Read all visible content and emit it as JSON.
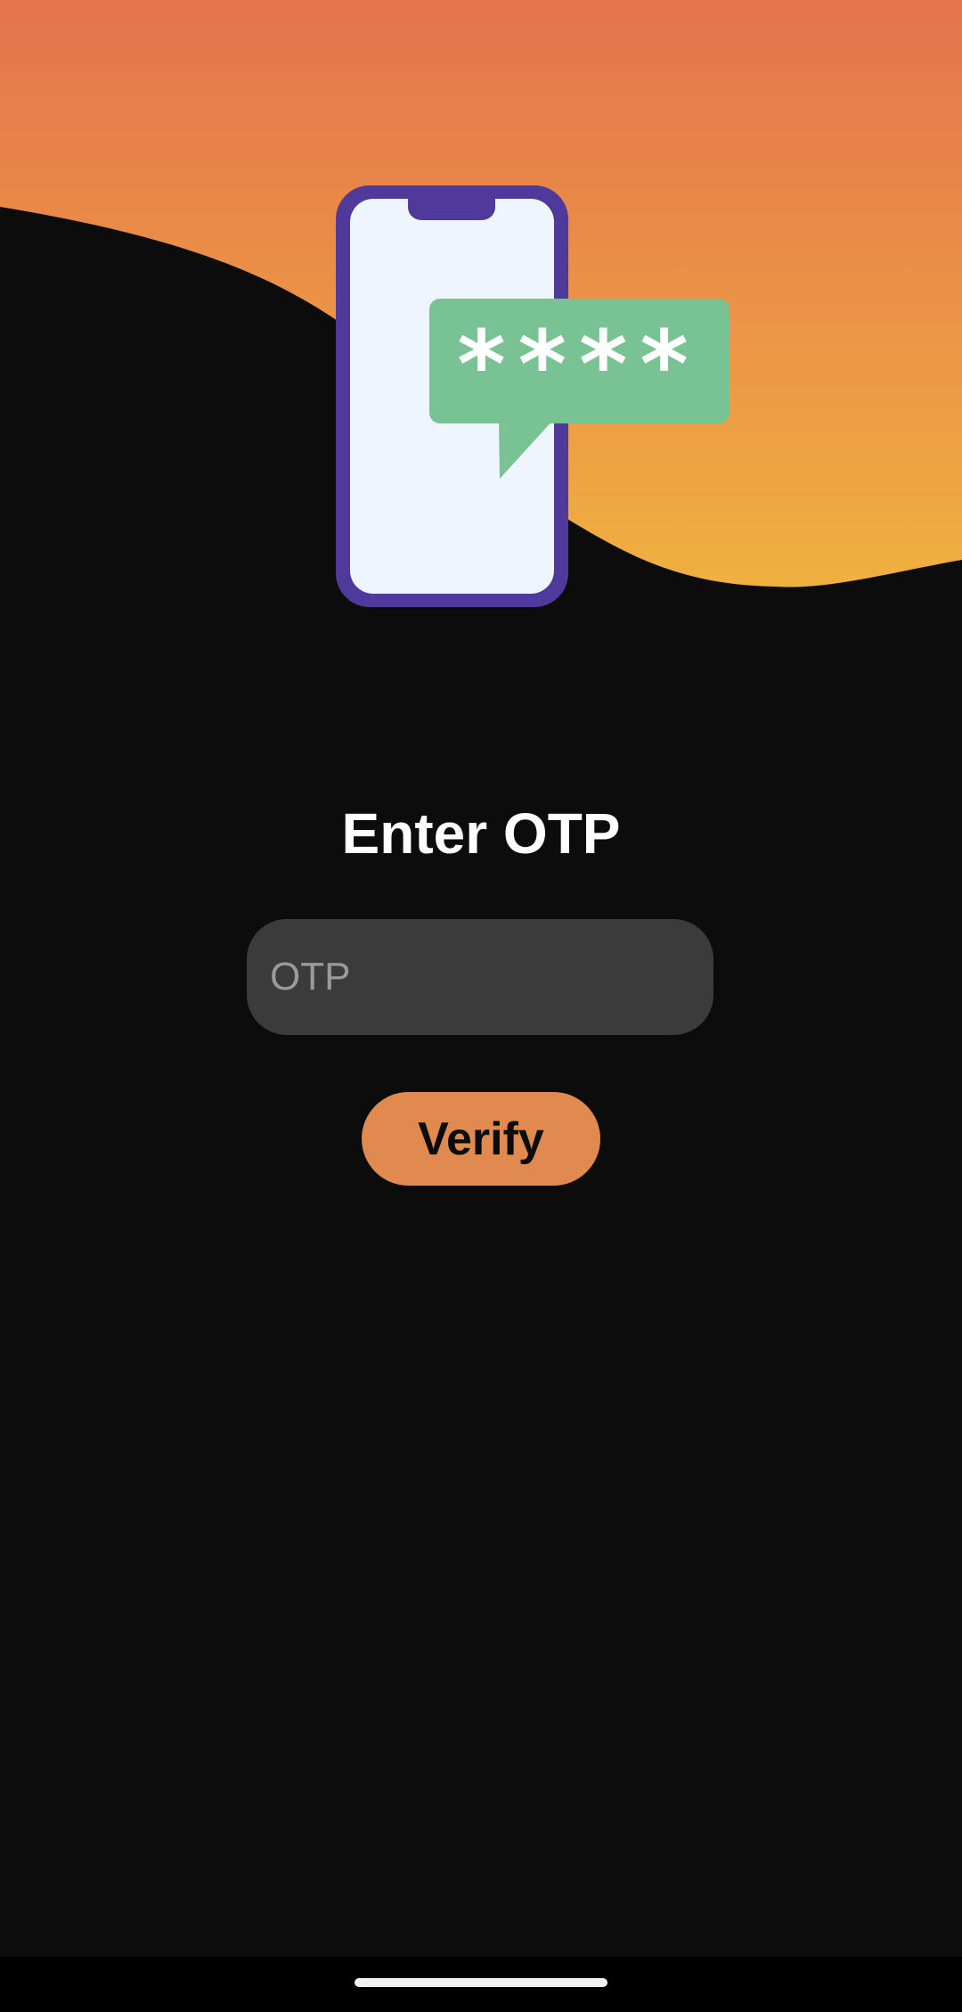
{
  "screen": {
    "title": "Enter OTP"
  },
  "otp_field": {
    "placeholder": "OTP",
    "value": ""
  },
  "verify_button": {
    "label": "Verify"
  },
  "illustration": {
    "message_text": "****"
  },
  "colors": {
    "background": "#0c0c0c",
    "gradient_top": "#e5734d",
    "gradient_bottom": "#f0b040",
    "phone_frame": "#4f3a9c",
    "phone_screen": "#eef5fc",
    "message_bubble": "#79c294",
    "input_background": "#3b3b3b",
    "button_background": "#e08a4f"
  }
}
